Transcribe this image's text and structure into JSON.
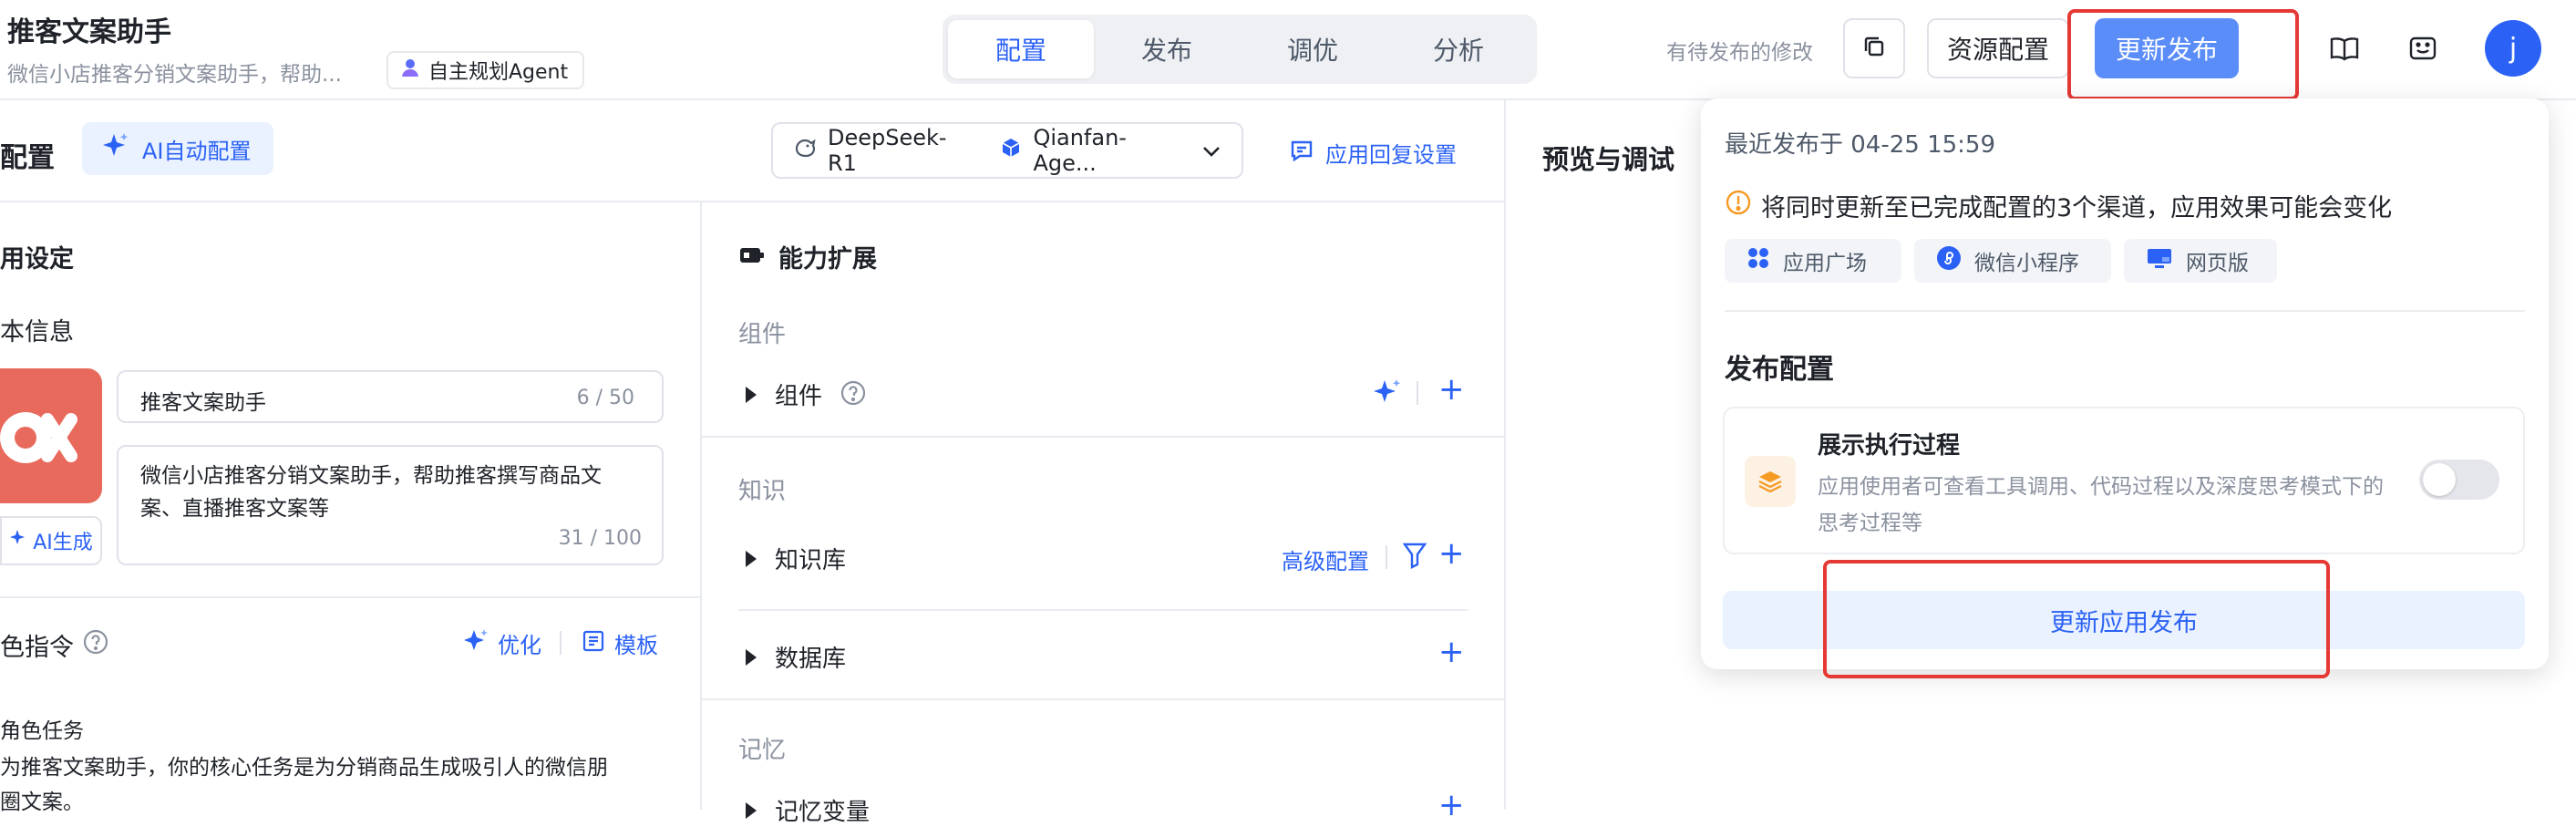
{
  "header": {
    "title": "推客文案助手",
    "subtitle": "微信小店推客分销文案助手，帮助...",
    "agent_badge": "自主规划Agent",
    "tabs": [
      "配置",
      "发布",
      "调优",
      "分析"
    ],
    "pending_text": "有待发布的修改",
    "resource_btn": "资源配置",
    "publish_btn": "更新发布",
    "avatar_letter": "j"
  },
  "config": {
    "title": "配置",
    "ai_config_btn": "AI自动配置",
    "model_name": "DeepSeek-R1",
    "agent_name": "Qianfan-Age...",
    "reply_settings": "应用回复设置"
  },
  "app_settings": {
    "title": "用设定",
    "basic_info": "本信息",
    "name_value": "推客文案助手",
    "name_count": "6 / 50",
    "desc_value": "微信小店推客分销文案助手，帮助推客撰写商品文案、直播推客文案等",
    "desc_count": "31 / 100",
    "ai_generate": "AI生成"
  },
  "role": {
    "title": "色指令",
    "optimize": "优化",
    "template": "模板",
    "task_title": "角色任务",
    "task_line1": "为推客文案助手，你的核心任务是为分销商品生成吸引人的微信朋",
    "task_line2": "圈文案。"
  },
  "ability": {
    "title": "能力扩展",
    "components_group": "组件",
    "components_item": "组件",
    "knowledge_group": "知识",
    "kb_item": "知识库",
    "advanced": "高级配置",
    "db_item": "数据库",
    "memory_group": "记忆",
    "memory_item": "记忆变量"
  },
  "preview": {
    "title": "预览与调试"
  },
  "popup": {
    "last_publish": "最近发布于 04-25 15:59",
    "warning": "将同时更新至已完成配置的3个渠道，应用效果可能会变化",
    "channels": [
      "应用广场",
      "微信小程序",
      "网页版"
    ],
    "config_title": "发布配置",
    "show_process_title": "展示执行过程",
    "show_process_desc1": "应用使用者可查看工具调用、代码过程以及深度思考模式下的",
    "show_process_desc2": "思考过程等",
    "show_process_on": false,
    "update_btn": "更新应用发布"
  },
  "colors": {
    "accent": "#2b62f5",
    "publish_btn": "#5b8df9",
    "highlight": "#e53935",
    "app_icon": "#e86a5c"
  }
}
